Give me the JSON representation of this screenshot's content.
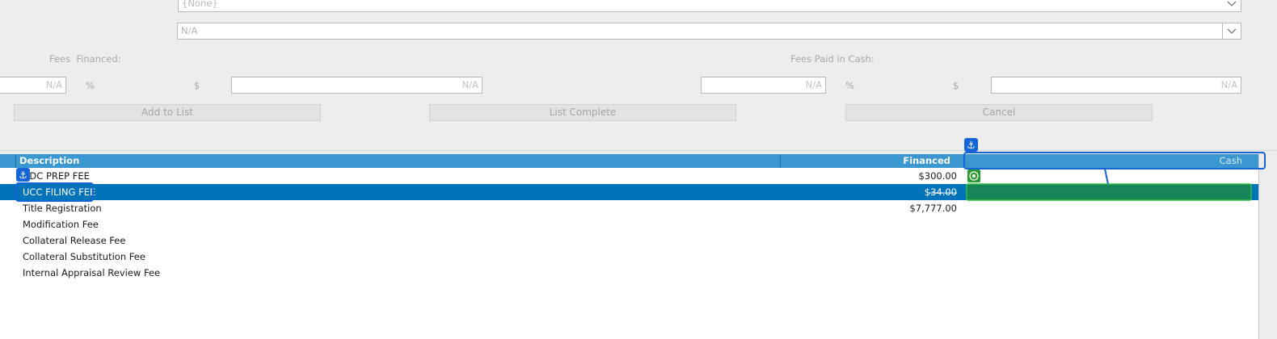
{
  "form": {
    "combo1_value": "{None}",
    "combo2_value": "N/A",
    "fees_financed_label": "Fees  Financed:",
    "fees_cash_label": "Fees Paid in Cash:",
    "fin_pct_value": "N/A",
    "fin_pct_symbol": "%",
    "fin_dollar_symbol": "$",
    "fin_amt_value": "N/A",
    "cash_pct_value": "N/A",
    "cash_pct_symbol": "%",
    "cash_dollar_symbol": "$",
    "cash_amt_value": "N/A",
    "add_button": "Add to List",
    "complete_button": "List Complete",
    "cancel_button": "Cancel"
  },
  "grid": {
    "columns": [
      "Description",
      "Financed",
      "Cash"
    ],
    "rows": [
      {
        "description": "UDC PREP FEE",
        "financed": "$300.00",
        "cash": ""
      },
      {
        "description": "UCC FILING FEE",
        "financed": "$34.00",
        "cash": ""
      },
      {
        "description": "Title Registration",
        "financed": "$7,777.00",
        "cash": ""
      },
      {
        "description": "Modification Fee",
        "financed": "",
        "cash": ""
      },
      {
        "description": "Collateral Release Fee",
        "financed": "",
        "cash": ""
      },
      {
        "description": "Collateral Substitution Fee",
        "financed": "",
        "cash": ""
      },
      {
        "description": "Internal Appraisal Review Fee",
        "financed": "",
        "cash": ""
      }
    ],
    "selected_row": 1
  },
  "overlay": {
    "anchor_icon": "⚓",
    "target_icon": "target-icon",
    "accent": "#1565d8",
    "drop_color": "#2a9a33"
  },
  "colors": {
    "header": "#3a97d0",
    "selection": "#0173b8",
    "background": "#ededed"
  }
}
